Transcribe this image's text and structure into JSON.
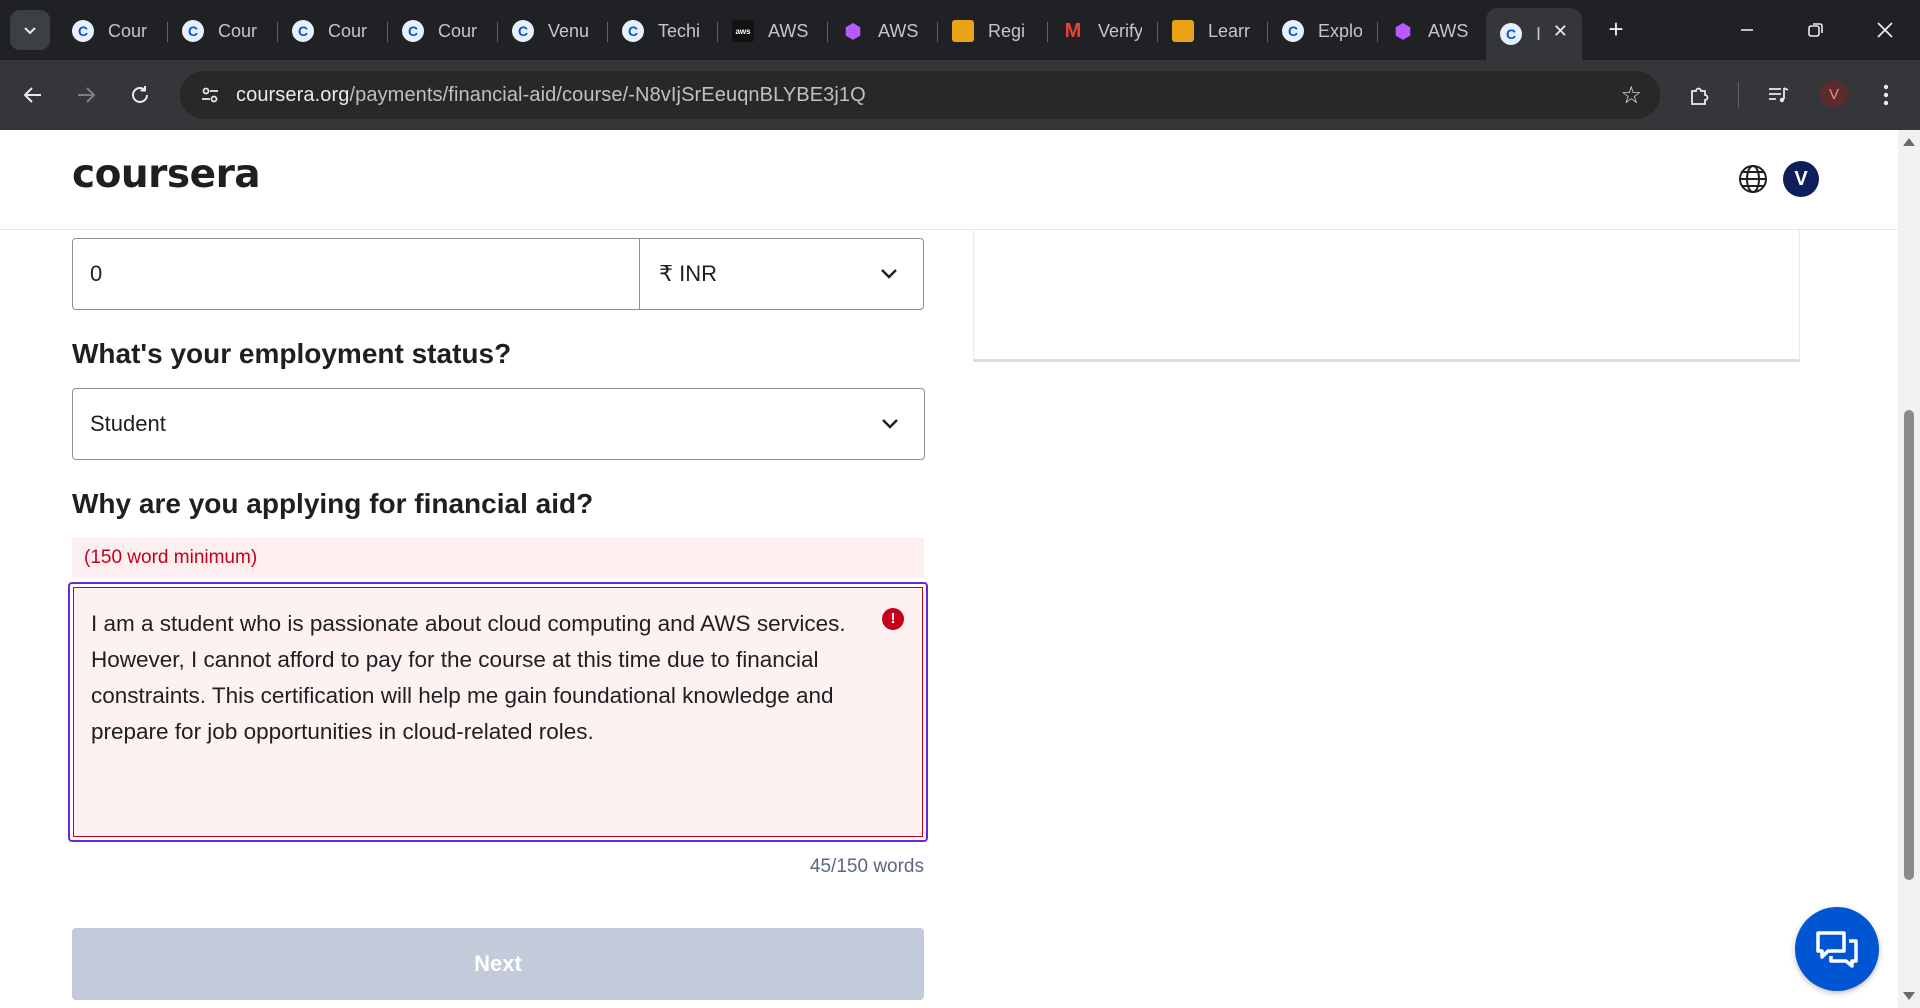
{
  "browser": {
    "tabs": [
      {
        "title": "Cour",
        "favicon": "coursera-icon"
      },
      {
        "title": "Cour",
        "favicon": "coursera-icon"
      },
      {
        "title": "Cour",
        "favicon": "coursera-icon"
      },
      {
        "title": "Cour",
        "favicon": "coursera-icon"
      },
      {
        "title": "Venu",
        "favicon": "coursera-icon"
      },
      {
        "title": "Techi",
        "favicon": "coursera-icon"
      },
      {
        "title": "AWS",
        "favicon": "aws-icon"
      },
      {
        "title": "AWS",
        "favicon": "cube-icon"
      },
      {
        "title": "Regi",
        "favicon": "box-icon"
      },
      {
        "title": "Verify",
        "favicon": "gmail-icon"
      },
      {
        "title": "Learr",
        "favicon": "box-icon"
      },
      {
        "title": "Explo",
        "favicon": "coursera-icon"
      },
      {
        "title": "AWS",
        "favicon": "cube-icon"
      },
      {
        "title": "I",
        "favicon": "coursera-icon",
        "active": true
      }
    ],
    "url_host": "coursera.org",
    "url_path": "/payments/financial-aid/course/-N8vIjSrEeuqnBLYBE3j1Q",
    "profile_initial": "V"
  },
  "header": {
    "logo_text": "coursera",
    "avatar_initial": "V"
  },
  "form": {
    "income_value": "0",
    "currency_value": "₹ INR",
    "employment_label": "What's your employment status?",
    "employment_value": "Student",
    "reason_label": "Why are you applying for financial aid?",
    "reason_minimum_note": "(150 word minimum)",
    "reason_lines": [
      "I am a student who is passionate about cloud computing and AWS services.",
      "However, I cannot afford to pay for the course at this time due to financial",
      "constraints. This certification will help me gain foundational knowledge and",
      "prepare for job opportunities in cloud-related roles."
    ],
    "word_count": "45/150 words",
    "next_label": "Next"
  },
  "colors": {
    "brand_blue": "#0056d2",
    "error_red": "#c4001b",
    "focus_purple": "#6b26d9",
    "disabled_button": "#c3cad9"
  }
}
